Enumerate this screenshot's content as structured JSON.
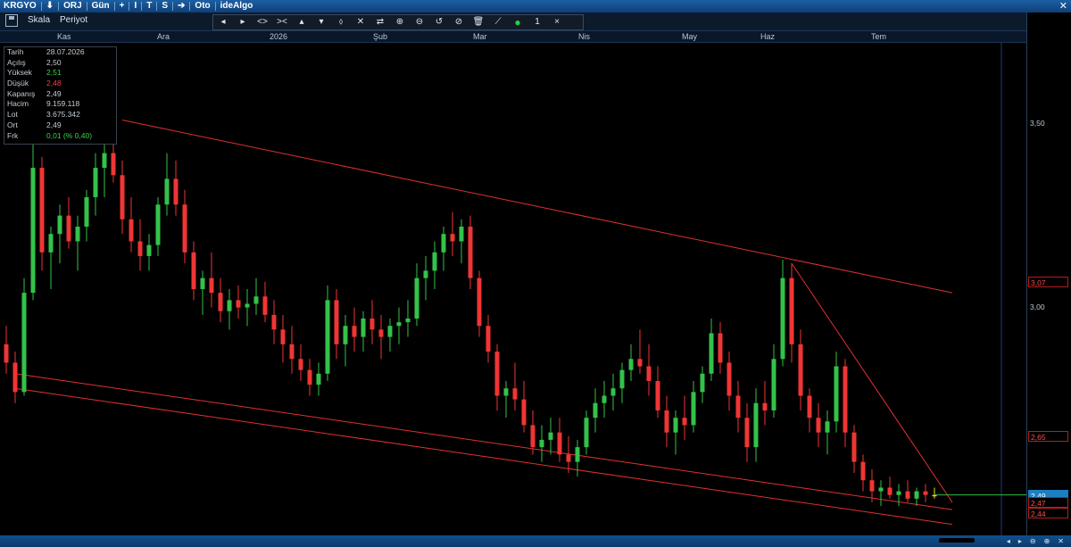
{
  "titlebar": {
    "items": [
      "KRGYO",
      "⬇",
      "ORJ",
      "Gün",
      "+",
      "I",
      "T",
      "S",
      "➔",
      "Oto",
      "ideAlgo"
    ],
    "close": "✕"
  },
  "toolbar": {
    "scale_label": "Skala",
    "period_label": "Periyot",
    "tools": [
      "◂",
      "▸",
      "<>",
      "><",
      "▴",
      "▾",
      "⬨",
      "✕",
      "⇄",
      "⊕",
      "⊖",
      "↺",
      "⊘",
      "🗑",
      "⟋",
      "●",
      "1",
      "×"
    ]
  },
  "months": [
    "Kas",
    "Ara",
    "2026",
    "Şub",
    "Mar",
    "Nis",
    "May",
    "Haz",
    "Tem"
  ],
  "info": [
    {
      "k": "Tarih",
      "v": "28.07.2026",
      "c": "#c5ccd3"
    },
    {
      "k": "Açılış",
      "v": "2,50",
      "c": "#c5ccd3"
    },
    {
      "k": "Yüksek",
      "v": "2,51",
      "c": "#39d34b"
    },
    {
      "k": "Düşük",
      "v": "2,48",
      "c": "#ff3b3b"
    },
    {
      "k": "Kapanış",
      "v": "2,49",
      "c": "#c5ccd3"
    },
    {
      "k": "Hacim",
      "v": "9.159.118",
      "c": "#c5ccd3"
    },
    {
      "k": "Lot",
      "v": "3.675.342",
      "c": "#c5ccd3"
    },
    {
      "k": "Ort",
      "v": "2,49",
      "c": "#c5ccd3"
    },
    {
      "k": "Frk",
      "v": "0,01 (% 0,40)",
      "c": "#39d34b"
    }
  ],
  "price_axis": {
    "ticks": [
      "3,50",
      "3,00"
    ],
    "labels": [
      {
        "text": "3,07",
        "current": false
      },
      {
        "text": "2,65",
        "current": false
      },
      {
        "text": "2,49",
        "current": true
      },
      {
        "text": "2,47",
        "current": false
      },
      {
        "text": "2,44",
        "current": false
      }
    ]
  },
  "statusbar": {
    "icons": [
      "◂",
      "▸",
      "⊖",
      "⊕",
      "✕"
    ]
  },
  "chart_data": {
    "type": "candlestick",
    "symbol": "KRGYO",
    "ylim": [
      2.38,
      3.72
    ],
    "colors": {
      "up": "#33c24a",
      "down": "#f03535",
      "doji": "#f2e01e",
      "trend": "#e03030"
    },
    "candles": [
      [
        2.9,
        2.95,
        2.82,
        2.85
      ],
      [
        2.85,
        2.88,
        2.74,
        2.77
      ],
      [
        2.77,
        3.08,
        2.76,
        3.04
      ],
      [
        3.04,
        3.45,
        3.02,
        3.38
      ],
      [
        3.38,
        3.41,
        3.1,
        3.15
      ],
      [
        3.15,
        3.22,
        3.05,
        3.2
      ],
      [
        3.2,
        3.28,
        3.12,
        3.25
      ],
      [
        3.25,
        3.3,
        3.16,
        3.18
      ],
      [
        3.18,
        3.25,
        3.1,
        3.22
      ],
      [
        3.22,
        3.32,
        3.18,
        3.3
      ],
      [
        3.3,
        3.42,
        3.25,
        3.38
      ],
      [
        3.38,
        3.46,
        3.3,
        3.42
      ],
      [
        3.42,
        3.47,
        3.34,
        3.36
      ],
      [
        3.36,
        3.4,
        3.2,
        3.24
      ],
      [
        3.24,
        3.3,
        3.15,
        3.18
      ],
      [
        3.18,
        3.24,
        3.1,
        3.14
      ],
      [
        3.14,
        3.2,
        3.1,
        3.17
      ],
      [
        3.17,
        3.3,
        3.14,
        3.28
      ],
      [
        3.28,
        3.42,
        3.25,
        3.35
      ],
      [
        3.35,
        3.4,
        3.25,
        3.28
      ],
      [
        3.28,
        3.32,
        3.12,
        3.15
      ],
      [
        3.15,
        3.18,
        3.02,
        3.05
      ],
      [
        3.05,
        3.1,
        2.98,
        3.08
      ],
      [
        3.08,
        3.15,
        3.0,
        3.04
      ],
      [
        3.04,
        3.08,
        2.96,
        2.99
      ],
      [
        2.99,
        3.05,
        2.94,
        3.02
      ],
      [
        3.02,
        3.06,
        2.97,
        3.0
      ],
      [
        3.0,
        3.05,
        2.95,
        3.01
      ],
      [
        3.01,
        3.08,
        2.98,
        3.03
      ],
      [
        3.03,
        3.07,
        2.96,
        2.98
      ],
      [
        2.98,
        3.02,
        2.9,
        2.94
      ],
      [
        2.94,
        2.98,
        2.85,
        2.9
      ],
      [
        2.9,
        2.95,
        2.82,
        2.86
      ],
      [
        2.86,
        2.9,
        2.8,
        2.83
      ],
      [
        2.83,
        2.86,
        2.76,
        2.79
      ],
      [
        2.79,
        2.85,
        2.76,
        2.82
      ],
      [
        2.82,
        3.06,
        2.8,
        3.02
      ],
      [
        3.02,
        3.05,
        2.86,
        2.9
      ],
      [
        2.9,
        2.98,
        2.84,
        2.95
      ],
      [
        2.95,
        3.0,
        2.88,
        2.92
      ],
      [
        2.92,
        2.99,
        2.88,
        2.97
      ],
      [
        2.97,
        3.02,
        2.9,
        2.94
      ],
      [
        2.94,
        2.98,
        2.86,
        2.92
      ],
      [
        2.92,
        2.97,
        2.88,
        2.95
      ],
      [
        2.95,
        3.0,
        2.9,
        2.96
      ],
      [
        2.96,
        3.02,
        2.92,
        2.97
      ],
      [
        2.97,
        3.12,
        2.95,
        3.08
      ],
      [
        3.08,
        3.14,
        3.02,
        3.1
      ],
      [
        3.1,
        3.18,
        3.05,
        3.15
      ],
      [
        3.15,
        3.22,
        3.1,
        3.2
      ],
      [
        3.2,
        3.26,
        3.14,
        3.18
      ],
      [
        3.18,
        3.24,
        3.12,
        3.22
      ],
      [
        3.22,
        3.25,
        3.05,
        3.08
      ],
      [
        3.08,
        3.1,
        2.92,
        2.95
      ],
      [
        2.95,
        2.98,
        2.85,
        2.88
      ],
      [
        2.88,
        2.9,
        2.72,
        2.76
      ],
      [
        2.76,
        2.8,
        2.7,
        2.78
      ],
      [
        2.78,
        2.85,
        2.72,
        2.75
      ],
      [
        2.75,
        2.8,
        2.66,
        2.68
      ],
      [
        2.68,
        2.72,
        2.6,
        2.62
      ],
      [
        2.62,
        2.68,
        2.58,
        2.64
      ],
      [
        2.64,
        2.7,
        2.6,
        2.66
      ],
      [
        2.66,
        2.7,
        2.58,
        2.6
      ],
      [
        2.6,
        2.65,
        2.55,
        2.58
      ],
      [
        2.58,
        2.64,
        2.54,
        2.62
      ],
      [
        2.62,
        2.72,
        2.6,
        2.7
      ],
      [
        2.7,
        2.78,
        2.66,
        2.74
      ],
      [
        2.74,
        2.8,
        2.7,
        2.76
      ],
      [
        2.76,
        2.82,
        2.72,
        2.78
      ],
      [
        2.78,
        2.85,
        2.74,
        2.83
      ],
      [
        2.83,
        2.9,
        2.8,
        2.86
      ],
      [
        2.86,
        2.94,
        2.82,
        2.84
      ],
      [
        2.84,
        2.9,
        2.76,
        2.8
      ],
      [
        2.8,
        2.84,
        2.7,
        2.72
      ],
      [
        2.72,
        2.76,
        2.62,
        2.66
      ],
      [
        2.66,
        2.72,
        2.6,
        2.7
      ],
      [
        2.7,
        2.76,
        2.64,
        2.68
      ],
      [
        2.68,
        2.8,
        2.66,
        2.77
      ],
      [
        2.77,
        2.84,
        2.74,
        2.82
      ],
      [
        2.82,
        2.97,
        2.8,
        2.93
      ],
      [
        2.93,
        2.96,
        2.82,
        2.85
      ],
      [
        2.85,
        2.88,
        2.72,
        2.76
      ],
      [
        2.76,
        2.8,
        2.66,
        2.7
      ],
      [
        2.7,
        2.74,
        2.58,
        2.62
      ],
      [
        2.62,
        2.78,
        2.58,
        2.74
      ],
      [
        2.74,
        2.8,
        2.68,
        2.72
      ],
      [
        2.72,
        2.9,
        2.7,
        2.86
      ],
      [
        2.86,
        3.13,
        2.84,
        3.08
      ],
      [
        3.08,
        3.12,
        2.85,
        2.9
      ],
      [
        2.9,
        2.94,
        2.72,
        2.76
      ],
      [
        2.76,
        2.78,
        2.66,
        2.7
      ],
      [
        2.7,
        2.74,
        2.62,
        2.66
      ],
      [
        2.66,
        2.72,
        2.6,
        2.69
      ],
      [
        2.69,
        2.88,
        2.66,
        2.84
      ],
      [
        2.84,
        2.86,
        2.62,
        2.66
      ],
      [
        2.66,
        2.68,
        2.55,
        2.58
      ],
      [
        2.58,
        2.6,
        2.5,
        2.53
      ],
      [
        2.53,
        2.56,
        2.47,
        2.5
      ],
      [
        2.5,
        2.53,
        2.46,
        2.51
      ],
      [
        2.51,
        2.54,
        2.48,
        2.49
      ],
      [
        2.49,
        2.52,
        2.46,
        2.5
      ],
      [
        2.5,
        2.53,
        2.47,
        2.48
      ],
      [
        2.48,
        2.51,
        2.46,
        2.5
      ],
      [
        2.5,
        2.52,
        2.47,
        2.49
      ],
      [
        2.49,
        2.51,
        2.48,
        2.49
      ]
    ],
    "trendlines": [
      {
        "from": [
          13,
          3.51
        ],
        "to": [
          106,
          3.04
        ]
      },
      {
        "from": [
          1,
          2.82
        ],
        "to": [
          106,
          2.45
        ]
      },
      {
        "from": [
          1,
          2.78
        ],
        "to": [
          106,
          2.41
        ]
      },
      {
        "from": [
          88,
          3.12
        ],
        "to": [
          106,
          2.47
        ]
      }
    ],
    "current_price": 2.49
  }
}
